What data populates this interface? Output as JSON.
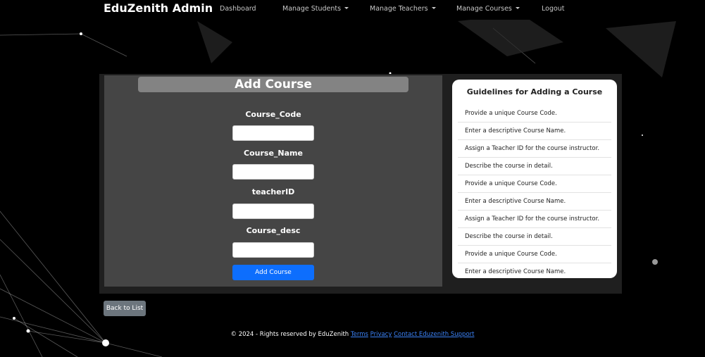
{
  "navbar": {
    "brand": "EduZenith Admin",
    "links": [
      {
        "label": "Dashboard"
      },
      {
        "label": "Manage Students"
      },
      {
        "label": "Manage Teachers"
      },
      {
        "label": "Manage Courses"
      },
      {
        "label": "Logout"
      }
    ]
  },
  "form": {
    "title": "Add Course",
    "fields": [
      {
        "label": "Course_Code",
        "value": ""
      },
      {
        "label": "Course_Name",
        "value": ""
      },
      {
        "label": "teacherID",
        "value": ""
      },
      {
        "label": "Course_desc",
        "value": ""
      }
    ],
    "submit_label": "Add Course"
  },
  "guidelines": {
    "title": "Guidelines for Adding a Course",
    "items": [
      "Provide a unique Course Code.",
      "Enter a descriptive Course Name.",
      "Assign a Teacher ID for the course instructor.",
      "Describe the course in detail.",
      "Provide a unique Course Code.",
      "Enter a descriptive Course Name.",
      "Assign a Teacher ID for the course instructor.",
      "Describe the course in detail.",
      "Provide a unique Course Code.",
      "Enter a descriptive Course Name."
    ]
  },
  "back_label": "Back to List",
  "footer": {
    "text": "© 2024 - Rights reserved by EduZenith",
    "links": [
      "Terms",
      "Privacy",
      "Contact Eduzenith Support"
    ]
  },
  "colors": {
    "primary": "#0d6efd",
    "secondary": "#6c757d",
    "panel": "#454545",
    "link": "#3b82f6"
  }
}
